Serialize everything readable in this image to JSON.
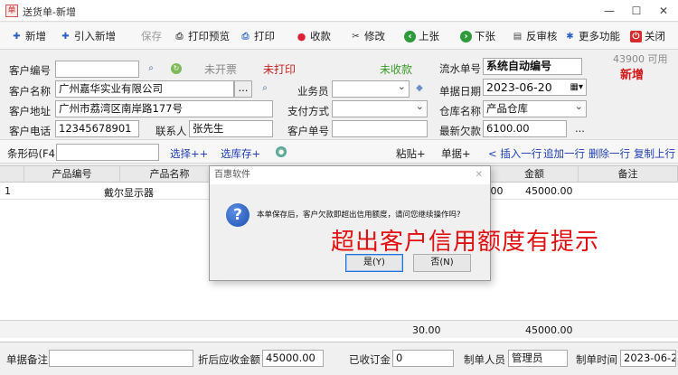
{
  "window": {
    "title": "送货单-新增",
    "controls": {
      "minimize": "—",
      "maximize": "☐",
      "close": "✕"
    }
  },
  "toolbar": [
    {
      "label": "新增",
      "icon": "plus-icon",
      "disabled": false
    },
    {
      "label": "引入新增",
      "icon": "plus-icon",
      "disabled": false
    },
    {
      "label": "保存",
      "icon": "",
      "disabled": true
    },
    {
      "label": "打印预览",
      "icon": "print-preview-icon",
      "disabled": false
    },
    {
      "label": "打印",
      "icon": "printer-icon",
      "disabled": false
    },
    {
      "label": "收款",
      "icon": "collect-payment-icon",
      "disabled": false
    },
    {
      "label": "修改",
      "icon": "edit-icon",
      "disabled": false
    },
    {
      "label": "上张",
      "icon": "previous-icon",
      "disabled": false
    },
    {
      "label": "下张",
      "icon": "next-icon",
      "disabled": false
    },
    {
      "label": "反审核",
      "icon": "unaudit-icon",
      "disabled": false
    },
    {
      "label": "更多功能",
      "icon": "more-functions-icon",
      "disabled": false
    },
    {
      "label": "关闭",
      "icon": "close-icon",
      "disabled": false
    }
  ],
  "form": {
    "customer_code_label": "客户编号",
    "customer_code": "",
    "print_status_unprinted": "未开票",
    "print_status": "未打印",
    "collect_status": "未收款",
    "serial_no_label": "流水单号",
    "serial_no": "系统自动编号",
    "quota_text": "43900 可用",
    "new_flag": "新增",
    "customer_name_label": "客户名称",
    "customer_name": "广州嘉华实业有限公司",
    "ellipsis": "...",
    "salesman_label": "业务员",
    "salesman": "",
    "doc_date_label": "单据日期",
    "doc_date": "2023-06-20",
    "address_label": "客户地址",
    "address": "广州市荔湾区南岸路177号",
    "pay_method_label": "支付方式",
    "pay_method": "",
    "warehouse_label": "仓库名称",
    "warehouse": "产品仓库",
    "phone_label": "客户电话",
    "phone": "12345678901",
    "contact_label": "联系人",
    "contact": "张先生",
    "customer_order_label": "客户单号",
    "customer_order": "",
    "latest_debt_label": "最新欠款",
    "latest_debt": "6100.00",
    "latest_debt_more": "..."
  },
  "strip": {
    "barcode_label": "条形码(F4)",
    "barcode_value": "",
    "select_link": "选择++",
    "select_stock_link": "选库存+",
    "paste_label": "粘贴+",
    "single_label": "单据+",
    "insert_row": "< 插入一行",
    "append_row": "追加一行",
    "delete_row": "删除一行",
    "copy_prev": "复制上行"
  },
  "grid": {
    "columns": [
      "产品编号",
      "产品名称",
      "金额",
      "备注"
    ],
    "rows": [
      {
        "no": "1",
        "code": "",
        "name": "戴尔显示器",
        "qty_tail": ".00",
        "amount": "45000.00",
        "note": ""
      }
    ],
    "footer": {
      "qty_total": "30.00",
      "amount_total": "45000.00"
    }
  },
  "bottom": {
    "remark_label": "单据备注",
    "remark": "",
    "discount_label": "折后应收金额",
    "discount_amount": "45000.00",
    "deposit_label": "已收订金",
    "deposit": "0",
    "maker_label": "制单人员",
    "maker": "管理员",
    "make_time_label": "制单时间",
    "make_time": "2023-06-20"
  },
  "dialog": {
    "title": "百惠软件",
    "close": "✕",
    "icon": "question-icon",
    "message": "本单保存后，客户欠款即超出信用额度，请问您继续操作吗?",
    "yes": "是(Y)",
    "no": "否(N)"
  },
  "annotation": "超出客户信用额度有提示",
  "colors": {
    "status_red": "#c62020",
    "status_green": "#3a9a2a",
    "link_blue": "#1f3fb5",
    "annotation_red": "#e01010"
  }
}
